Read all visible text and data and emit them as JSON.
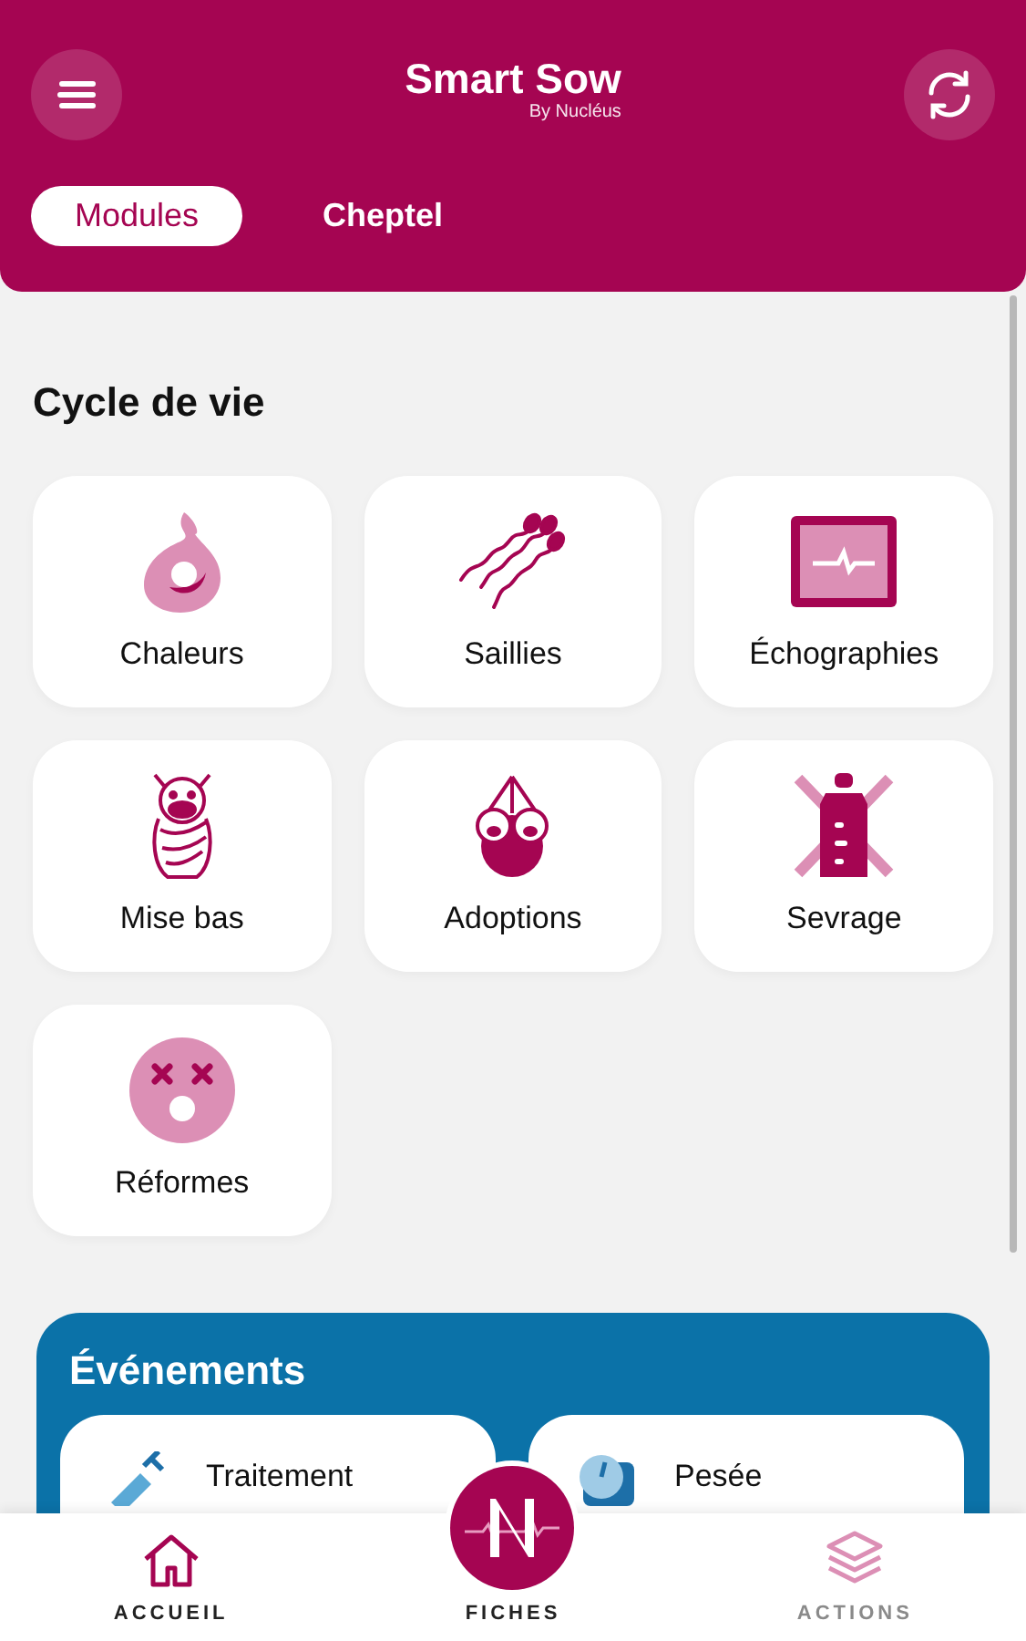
{
  "header": {
    "title": "Smart Sow",
    "subtitle": "By Nucléus"
  },
  "tabs": [
    {
      "label": "Modules",
      "selected": true
    },
    {
      "label": "Cheptel",
      "selected": false
    }
  ],
  "section": {
    "title": "Cycle de vie"
  },
  "modules": [
    {
      "label": "Chaleurs"
    },
    {
      "label": "Saillies"
    },
    {
      "label": "Échographies"
    },
    {
      "label": "Mise bas"
    },
    {
      "label": "Adoptions"
    },
    {
      "label": "Sevrage"
    },
    {
      "label": "Réformes"
    }
  ],
  "events": {
    "title": "Événements",
    "items": [
      {
        "label": "Traitement"
      },
      {
        "label": "Pesée"
      }
    ]
  },
  "bottom_nav": [
    {
      "label": "ACCUEIL",
      "kind": "tab",
      "disabled": false
    },
    {
      "label": "FICHES",
      "kind": "center",
      "disabled": false
    },
    {
      "label": "ACTIONS",
      "kind": "tab",
      "disabled": true
    }
  ]
}
